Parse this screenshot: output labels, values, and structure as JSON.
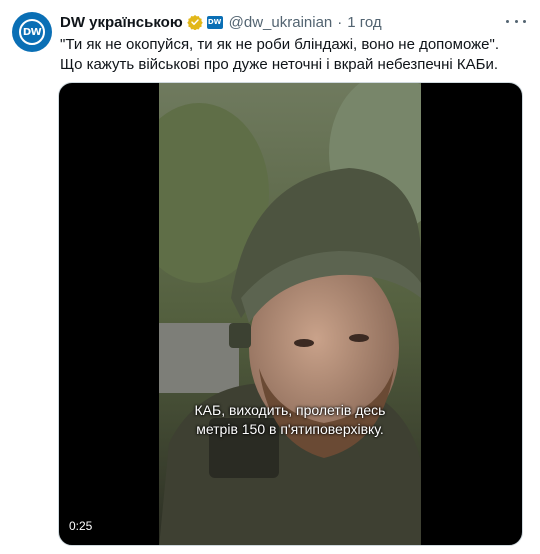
{
  "account": {
    "name": "DW українською",
    "handle": "@dw_ukrainian",
    "separator": "·",
    "time": "1 год",
    "avatar_text": "DW",
    "affiliate_badge_text": "DW"
  },
  "tweet": {
    "text": "\"Ти як не окопуйся, ти як не роби бліндажі, воно не допоможе\". Що кажуть військові про дуже неточні і вкрай небезпечні КАБи."
  },
  "video": {
    "subtitle_line1": "КАБ, виходить, пролетів десь",
    "subtitle_line2": "метрів 150 в п'ятиповерхівку.",
    "duration": "0:25"
  },
  "icons": {
    "verified": "verified-badge-icon",
    "more": "more-options-icon"
  },
  "colors": {
    "brand": "#0a6fb5",
    "verified": "#e2b719",
    "text": "#0f1419",
    "secondary_text": "#536471"
  }
}
